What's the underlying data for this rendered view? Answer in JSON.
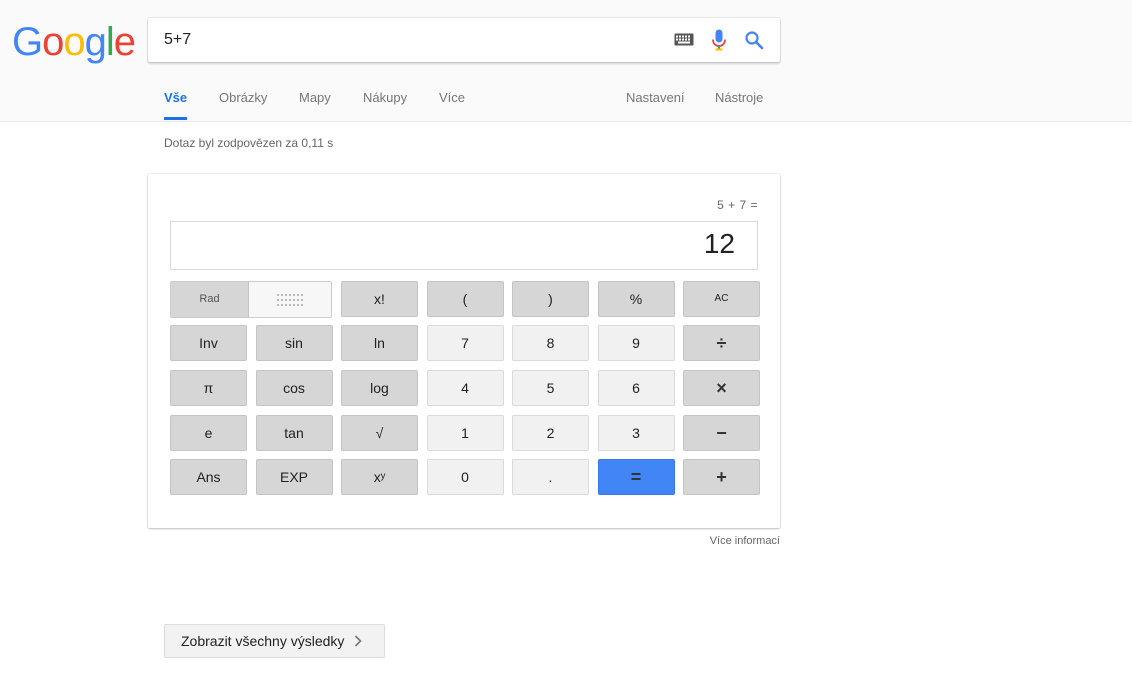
{
  "logo": {
    "letters": [
      "G",
      "o",
      "o",
      "g",
      "l",
      "e"
    ],
    "colors": [
      "#4285f4",
      "#ea4335",
      "#fbbc05",
      "#4285f4",
      "#34a853",
      "#ea4335"
    ]
  },
  "search": {
    "query": "5+7",
    "icons": [
      "keyboard-icon",
      "microphone-icon",
      "search-icon"
    ]
  },
  "tabs": {
    "items": [
      {
        "label": "Vše",
        "active": true
      },
      {
        "label": "Obrázky"
      },
      {
        "label": "Mapy"
      },
      {
        "label": "Nákupy"
      },
      {
        "label": "Více"
      }
    ],
    "settings": "Nastavení",
    "tools": "Nástroje"
  },
  "stats": "Dotaz byl zodpovězen za 0,11 s",
  "calculator": {
    "expression": "5 + 7 =",
    "result": "12",
    "mode_rad": "Rad",
    "rows": [
      [
        {
          "label": "x!",
          "style": "dark",
          "name": "factorial"
        },
        {
          "label": "(",
          "style": "dark",
          "name": "open-paren"
        },
        {
          "label": ")",
          "style": "dark",
          "name": "close-paren"
        },
        {
          "label": "%",
          "style": "dark",
          "name": "percent"
        },
        {
          "label": "AC",
          "style": "dark",
          "name": "all-clear"
        }
      ],
      [
        {
          "label": "Inv",
          "style": "dark",
          "name": "inverse"
        },
        {
          "label": "sin",
          "style": "dark",
          "name": "sin"
        },
        {
          "label": "ln",
          "style": "dark",
          "name": "ln"
        },
        {
          "label": "7",
          "style": "light",
          "name": "digit-7"
        },
        {
          "label": "8",
          "style": "light",
          "name": "digit-8"
        },
        {
          "label": "9",
          "style": "light",
          "name": "digit-9"
        },
        {
          "label": "÷",
          "style": "dark",
          "name": "divide"
        }
      ],
      [
        {
          "label": "π",
          "style": "dark",
          "name": "pi"
        },
        {
          "label": "cos",
          "style": "dark",
          "name": "cos"
        },
        {
          "label": "log",
          "style": "dark",
          "name": "log"
        },
        {
          "label": "4",
          "style": "light",
          "name": "digit-4"
        },
        {
          "label": "5",
          "style": "light",
          "name": "digit-5"
        },
        {
          "label": "6",
          "style": "light",
          "name": "digit-6"
        },
        {
          "label": "×",
          "style": "dark",
          "name": "multiply"
        }
      ],
      [
        {
          "label": "e",
          "style": "dark",
          "name": "euler"
        },
        {
          "label": "tan",
          "style": "dark",
          "name": "tan"
        },
        {
          "label": "√",
          "style": "dark",
          "name": "square-root"
        },
        {
          "label": "1",
          "style": "light",
          "name": "digit-1"
        },
        {
          "label": "2",
          "style": "light",
          "name": "digit-2"
        },
        {
          "label": "3",
          "style": "light",
          "name": "digit-3"
        },
        {
          "label": "−",
          "style": "dark",
          "name": "subtract"
        }
      ],
      [
        {
          "label": "Ans",
          "style": "dark",
          "name": "answer"
        },
        {
          "label": "EXP",
          "style": "dark",
          "name": "exponent"
        },
        {
          "label": "xʸ",
          "style": "dark",
          "name": "power"
        },
        {
          "label": "0",
          "style": "light",
          "name": "digit-0"
        },
        {
          "label": ".",
          "style": "light",
          "name": "decimal-point"
        },
        {
          "label": "=",
          "style": "eq",
          "name": "equals"
        },
        {
          "label": "+",
          "style": "dark",
          "name": "add"
        }
      ]
    ]
  },
  "more_info": "Více informací",
  "show_all": "Zobrazit všechny výsledky",
  "accent_color": "#4285f4"
}
